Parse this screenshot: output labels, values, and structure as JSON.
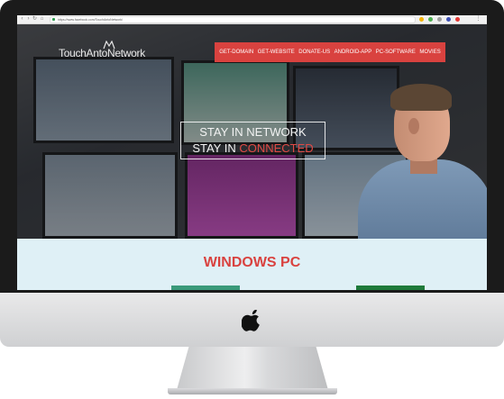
{
  "browser": {
    "url": "https://www.facebook.com/TouchAntoNetwork/",
    "nav_icons": [
      "back-arrow-icon",
      "forward-arrow-icon",
      "reload-icon",
      "home-icon"
    ],
    "extension_colors": [
      "#f4b400",
      "#4caf50",
      "#9e9e9e",
      "#3f51b5",
      "#e53935"
    ]
  },
  "site": {
    "logo_text": "TouchAntoNetwork",
    "menu": [
      "GET-DOMAIN",
      "GET-WEBSITE",
      "DONATE-US",
      "ANDROID-APP",
      "PC-SOFTWARE",
      "MOVIES"
    ],
    "menu_color": "#d9423f",
    "hero": {
      "line1": "STAY IN NETWORK",
      "line2_prefix": "STAY IN ",
      "line2_highlight": "CONNECTED",
      "highlight_color": "#e04a45"
    },
    "section": {
      "title": "WINDOWS PC",
      "title_color": "#d9423f",
      "background": "#dff0f6"
    }
  },
  "device": {
    "frame": "imac",
    "logo": "apple-logo-icon"
  }
}
